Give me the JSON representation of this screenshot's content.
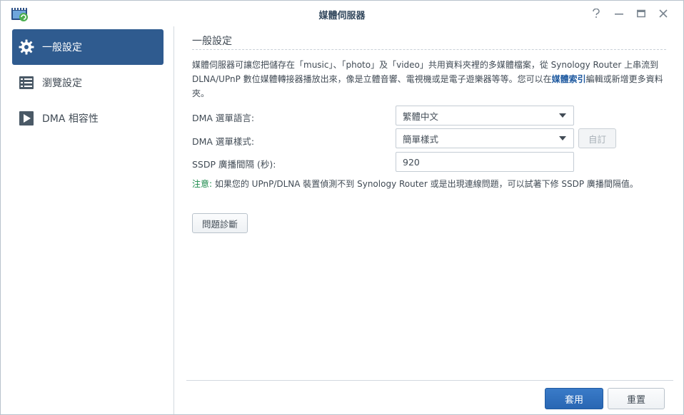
{
  "window": {
    "title": "媒體伺服器",
    "controls": [
      "help-icon",
      "minimize-icon",
      "maximize-icon",
      "close-icon"
    ]
  },
  "sidebar": {
    "items": [
      {
        "label": "一般設定",
        "icon": "gear-icon",
        "active": true
      },
      {
        "label": "瀏覽設定",
        "icon": "list-icon",
        "active": false
      },
      {
        "label": "DMA 相容性",
        "icon": "play-icon",
        "active": false
      }
    ]
  },
  "main": {
    "section_title": "一般設定",
    "description_pre": "媒體伺服器可讓您把儲存在「music」、「photo」及「video」共用資料夾裡的多媒體檔案，從 Synology Router 上串流到 DLNA/UPnP 數位媒體轉接器播放出來，像是立體音響、電視機或是電子遊樂器等等。您可以在",
    "description_link": "媒體索引",
    "description_post": "編輯或新增更多資料夾。",
    "fields": {
      "menu_language": {
        "label": "DMA 選單語言:",
        "value": "繁體中文"
      },
      "menu_style": {
        "label": "DMA 選單樣式:",
        "value": "簡單樣式",
        "custom_button": "自訂"
      },
      "ssdp_interval": {
        "label": "SSDP 廣播間隔 (秒):",
        "value": "920"
      }
    },
    "note_tag": "注意:",
    "note_text": " 如果您的 UPnP/DLNA 裝置偵測不到 Synology Router 或是出現連線問題，可以試著下修 SSDP 廣播間隔值。",
    "diagnose_button": "問題診斷"
  },
  "footer": {
    "apply_label": "套用",
    "reset_label": "重置"
  },
  "colors": {
    "accent": "#2f5b8f",
    "apply": "#2866b3",
    "note": "#1b8a4b"
  }
}
